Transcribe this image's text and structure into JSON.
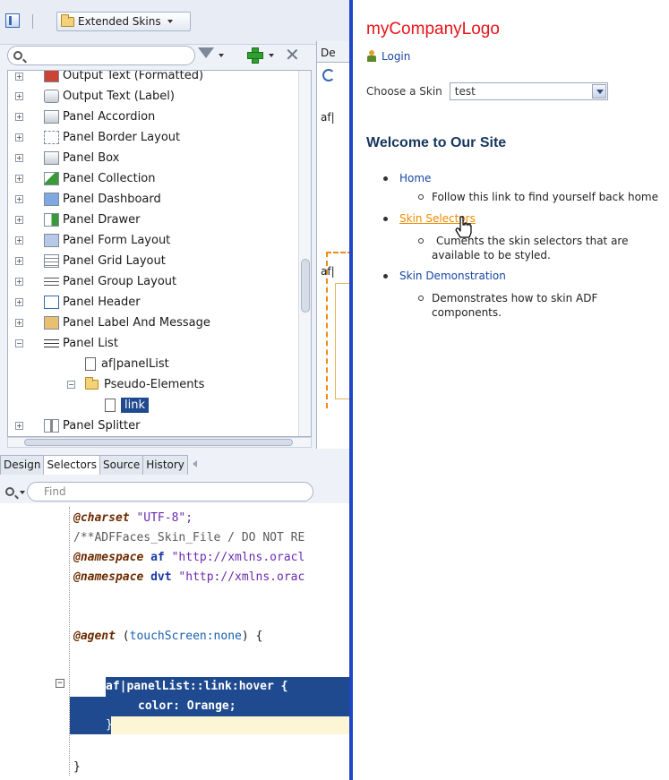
{
  "toolbar": {
    "skins_dropdown_label": "Extended Skins",
    "search_placeholder": ""
  },
  "tree": {
    "items": [
      {
        "label": "Output Text (Formatted)"
      },
      {
        "label": "Output Text (Label)"
      },
      {
        "label": "Panel Accordion"
      },
      {
        "label": "Panel Border Layout"
      },
      {
        "label": "Panel Box"
      },
      {
        "label": "Panel Collection"
      },
      {
        "label": "Panel Dashboard"
      },
      {
        "label": "Panel Drawer"
      },
      {
        "label": "Panel Form Layout"
      },
      {
        "label": "Panel Grid Layout"
      },
      {
        "label": "Panel Group Layout"
      },
      {
        "label": "Panel Header"
      },
      {
        "label": "Panel Label And Message"
      },
      {
        "label": "Panel List"
      },
      {
        "label": "af|panelList"
      },
      {
        "label": "Pseudo-Elements"
      },
      {
        "label": "link"
      },
      {
        "label": "Panel Splitter"
      }
    ]
  },
  "side_editor": {
    "tab_label": "De",
    "frag1": "af|",
    "frag2": "af|"
  },
  "bottom_tabs": [
    "Design",
    "Selectors",
    "Source",
    "History"
  ],
  "find": {
    "placeholder": "Find"
  },
  "code": {
    "line1_kw": "@charset",
    "line1_str": "\"UTF-8\";",
    "line2": "/**ADFFaces_Skin_File / DO NOT RE",
    "line3_kw": "@namespace",
    "line3_ns": "af",
    "line3_str": "\"http://xmlns.oracl",
    "line4_kw": "@namespace",
    "line4_ns": "dvt",
    "line4_str": "\"http://xmlns.orac",
    "line5_kw": "@agent",
    "line5_open": "(",
    "line5_id": "touchScreen:none",
    "line5_close": ") {",
    "line6": "af|panelList::link:hover {",
    "line7": "color: Orange;",
    "line8": "}",
    "line9": "}"
  },
  "page": {
    "logo": "myCompanyLogo",
    "login": "Login",
    "skin_label": "Choose a Skin",
    "skin_value": "test",
    "welcome": "Welcome to Our Site",
    "links": [
      {
        "label": "Home",
        "desc": "Follow this link to find yourself back home"
      },
      {
        "label": "Skin Selectors",
        "desc_line1": "Cuments the skin selectors that are",
        "desc_line2": "available to be styled."
      },
      {
        "label": "Skin Demonstration",
        "desc_line1": "Demonstrates how to skin ADF",
        "desc_line2": "components."
      }
    ]
  },
  "colors": {
    "logo": "#e8131a",
    "link": "#1746a3",
    "link_hover": "#f08a00",
    "selection": "#1f4a8f",
    "divider": "#2045c8"
  }
}
